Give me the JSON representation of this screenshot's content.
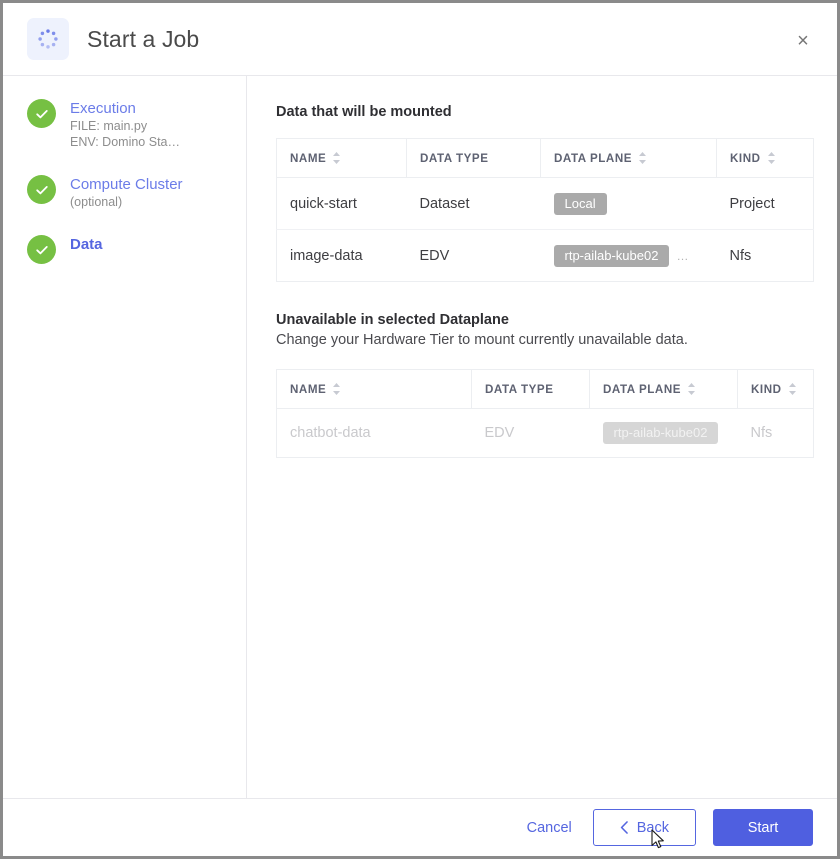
{
  "window": {
    "title": "Start a Job",
    "header_icon": "loading-spinner-icon",
    "close_icon": "close-icon",
    "close_label": "×",
    "accent_color": "#5566e0",
    "primary_button_color": "#4f5fe0",
    "step_complete_color": "#76c043",
    "badge_color": "#aaaaaa"
  },
  "sidebar": {
    "steps": [
      {
        "label": "Execution",
        "status_icon": "check-circle-icon",
        "sub1": "FILE: main.py",
        "sub2": "ENV: Domino Sta…",
        "active": false
      },
      {
        "label": "Compute Cluster",
        "status_icon": "check-circle-icon",
        "sub1": "(optional)",
        "sub2": "",
        "active": false
      },
      {
        "label": "Data",
        "status_icon": "check-circle-icon",
        "sub1": "",
        "sub2": "",
        "active": true
      }
    ]
  },
  "main": {
    "mounted": {
      "title": "Data that will be mounted",
      "columns": [
        {
          "label": "NAME",
          "sortable": true
        },
        {
          "label": "DATA TYPE",
          "sortable": false
        },
        {
          "label": "DATA PLANE",
          "sortable": true
        },
        {
          "label": "KIND",
          "sortable": true
        }
      ],
      "rows": [
        {
          "name": "quick-start",
          "data_type": "Dataset",
          "data_plane": "Local",
          "data_plane_overflow": "",
          "kind": "Project"
        },
        {
          "name": "image-data",
          "data_type": "EDV",
          "data_plane": "rtp-ailab-kube02",
          "data_plane_overflow": "…",
          "kind": "Nfs"
        }
      ]
    },
    "unavailable": {
      "title": "Unavailable in selected Dataplane",
      "subtitle": "Change your Hardware Tier to mount currently unavailable data.",
      "columns": [
        {
          "label": "NAME",
          "sortable": true
        },
        {
          "label": "DATA TYPE",
          "sortable": false
        },
        {
          "label": "DATA PLANE",
          "sortable": true
        },
        {
          "label": "KIND",
          "sortable": true
        }
      ],
      "rows": [
        {
          "name": "chatbot-data",
          "data_type": "EDV",
          "data_plane": "rtp-ailab-kube02",
          "data_plane_overflow": "",
          "kind": "Nfs"
        }
      ]
    }
  },
  "footer": {
    "cancel_label": "Cancel",
    "back_label": "Back",
    "back_icon": "chevron-left-icon",
    "start_label": "Start"
  }
}
